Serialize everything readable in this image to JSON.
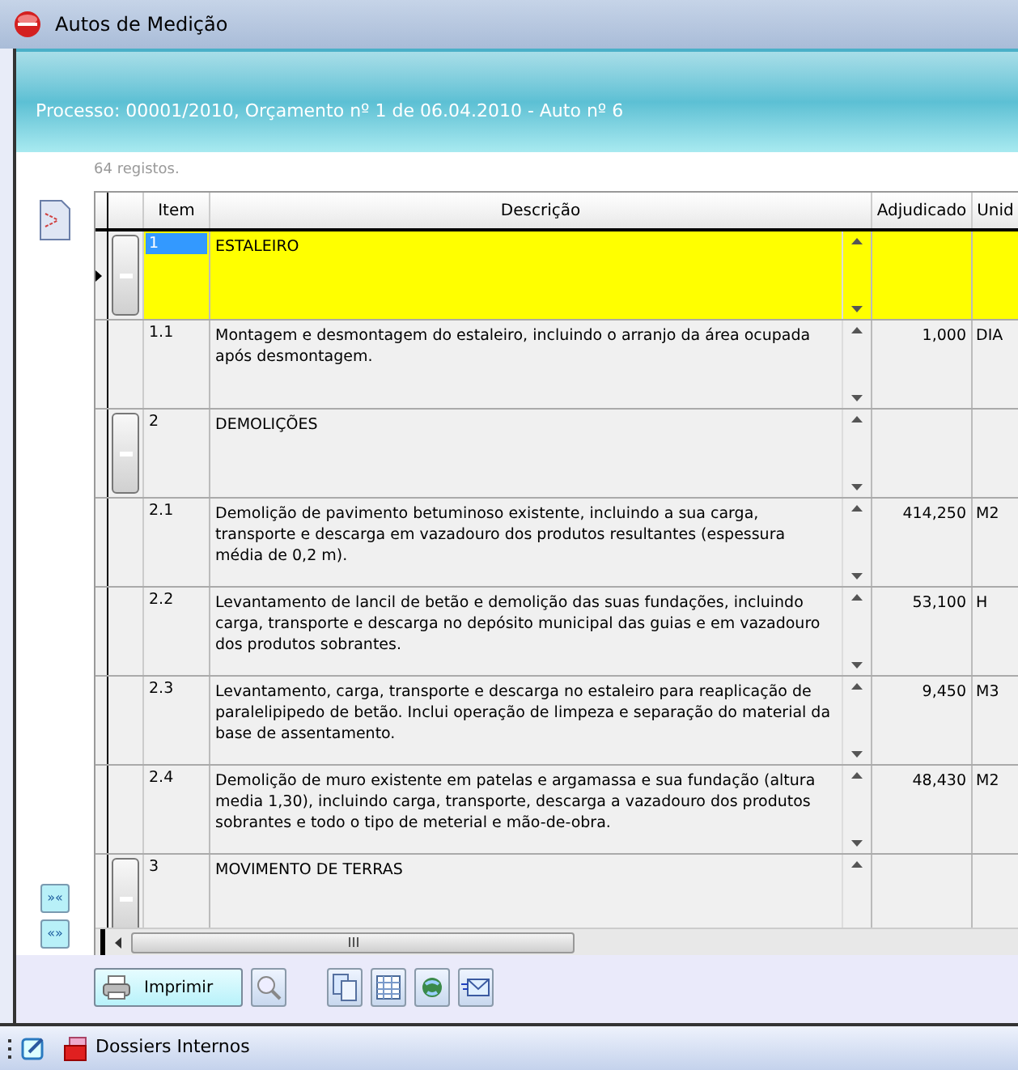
{
  "window": {
    "title": "Autos de Medição"
  },
  "header": {
    "subtitle": "Processo: 00001/2010, Orçamento nº 1 de 06.04.2010 - Auto nº 6"
  },
  "record_count": "64 registos.",
  "table": {
    "columns": [
      "Item",
      "Descrição",
      "Adjudicado",
      "Unid"
    ],
    "rows": [
      {
        "kind": "group",
        "selected": true,
        "item": "1",
        "description": "ESTALEIRO",
        "adjudicado": "",
        "unid": ""
      },
      {
        "kind": "item",
        "selected": false,
        "item": "1.1",
        "description": "Montagem e desmontagem do estaleiro, incluindo o arranjo da área ocupada após desmontagem.",
        "adjudicado": "1,000",
        "unid": "DIA"
      },
      {
        "kind": "group",
        "selected": false,
        "item": "2",
        "description": "DEMOLIÇÕES",
        "adjudicado": "",
        "unid": ""
      },
      {
        "kind": "item",
        "selected": false,
        "item": "2.1",
        "description": "Demolição de pavimento betuminoso existente, incluindo a sua carga, transporte e descarga em vazadouro dos produtos resultantes (espessura média de 0,2 m).",
        "adjudicado": "414,250",
        "unid": "M2"
      },
      {
        "kind": "item",
        "selected": false,
        "item": "2.2",
        "description": "Levantamento de lancil de betão e demolição das suas fundações, incluindo carga, transporte e descarga no depósito municipal das guias e em vazadouro dos produtos sobrantes.",
        "adjudicado": "53,100",
        "unid": "H"
      },
      {
        "kind": "item",
        "selected": false,
        "item": "2.3",
        "description": "Levantamento, carga, transporte e descarga no estaleiro para reaplicação de paralelipipedo de betão. Inclui operação de limpeza e separação do material da base de assentamento.",
        "adjudicado": "9,450",
        "unid": "M3"
      },
      {
        "kind": "item",
        "selected": false,
        "item": "2.4",
        "description": "Demolição de muro existente em patelas e argamassa e sua fundação (altura media 1,30), incluindo carga, transporte, descarga a vazadouro dos produtos sobrantes e todo o tipo de meterial e mão-de-obra.",
        "adjudicado": "48,430",
        "unid": "M2"
      },
      {
        "kind": "group",
        "selected": false,
        "item": "3",
        "description": "MOVIMENTO DE TERRAS",
        "adjudicado": "",
        "unid": ""
      }
    ]
  },
  "side_buttons": [
    "»«",
    "«»"
  ],
  "print_button": {
    "label": "Imprimir"
  },
  "taskbar": {
    "item": "Dossiers Internos"
  }
}
